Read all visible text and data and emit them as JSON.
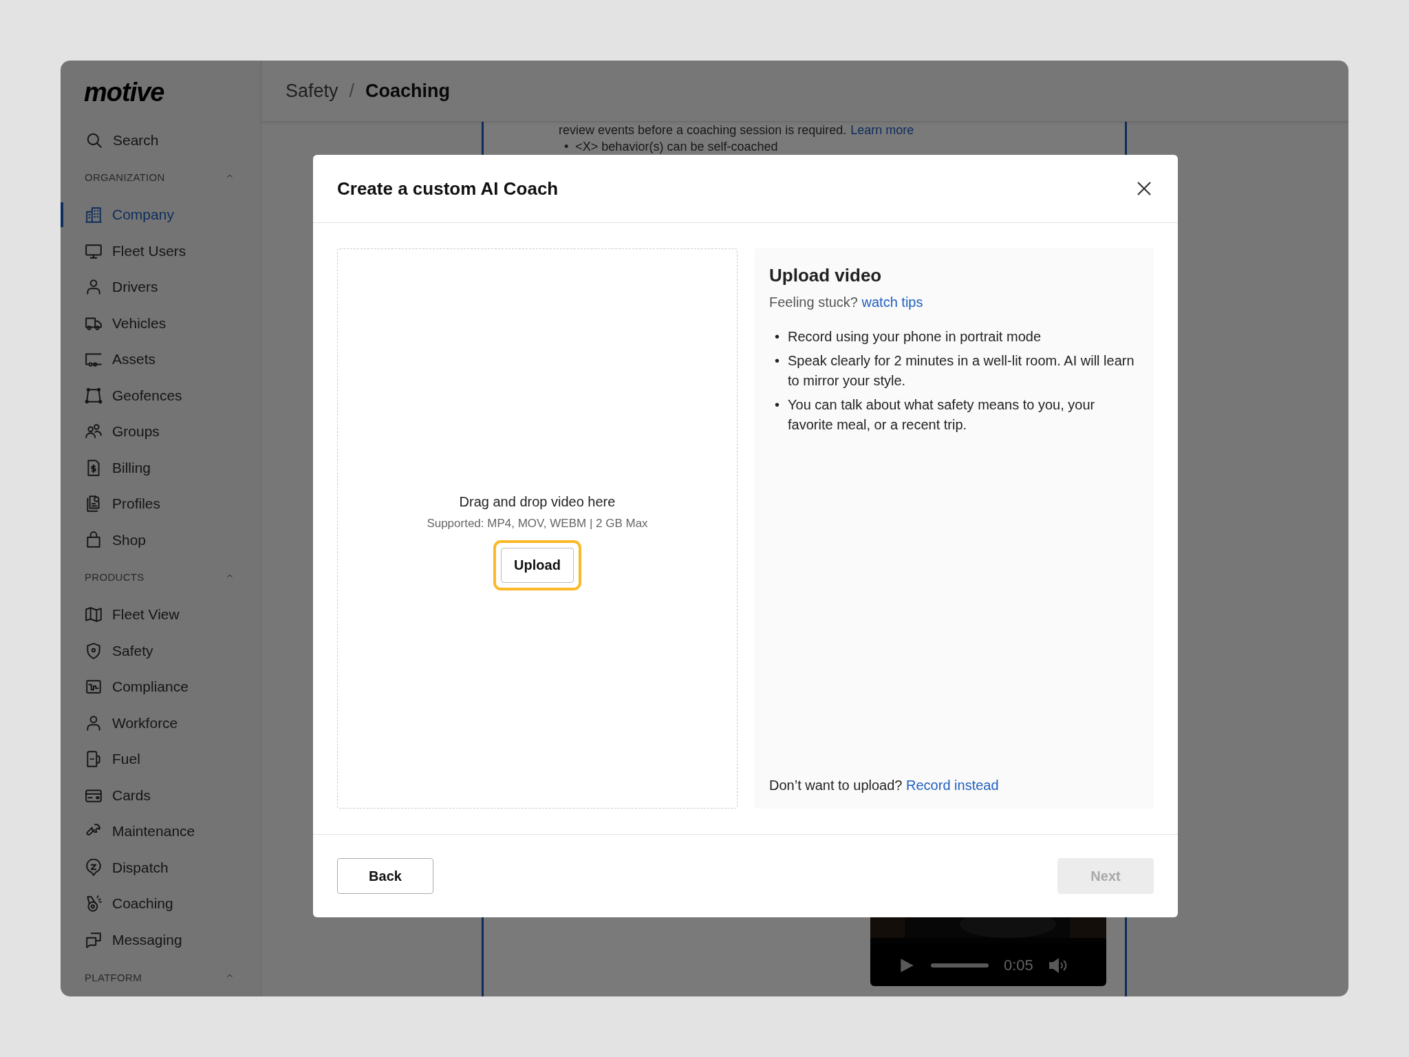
{
  "sidebar": {
    "logo": "motive",
    "search": "Search",
    "sections": [
      {
        "title": "ORGANIZATION",
        "expanded": true,
        "items": [
          {
            "label": "Company",
            "selected": true
          },
          {
            "label": "Fleet Users",
            "selected": false
          },
          {
            "label": "Drivers",
            "selected": false
          },
          {
            "label": "Vehicles",
            "selected": false
          },
          {
            "label": "Assets",
            "selected": false
          },
          {
            "label": "Geofences",
            "selected": false
          },
          {
            "label": "Groups",
            "selected": false
          },
          {
            "label": "Billing",
            "selected": false
          },
          {
            "label": "Profiles",
            "selected": false
          },
          {
            "label": "Shop",
            "selected": false
          }
        ]
      },
      {
        "title": "PRODUCTS",
        "expanded": true,
        "items": [
          {
            "label": "Fleet View",
            "selected": false
          },
          {
            "label": "Safety",
            "selected": false
          },
          {
            "label": "Compliance",
            "selected": false
          },
          {
            "label": "Workforce",
            "selected": false
          },
          {
            "label": "Fuel",
            "selected": false
          },
          {
            "label": "Cards",
            "selected": false
          },
          {
            "label": "Maintenance",
            "selected": false
          },
          {
            "label": "Dispatch",
            "selected": false
          },
          {
            "label": "Coaching",
            "selected": false
          },
          {
            "label": "Messaging",
            "selected": false
          }
        ]
      },
      {
        "title": "PLATFORM",
        "expanded": true
      }
    ]
  },
  "breadcrumb": {
    "parent": "Safety",
    "separator": "/",
    "current": "Coaching"
  },
  "background": {
    "text": "review events before a coaching session is required.",
    "link": "Learn more",
    "bullet_marker": "•",
    "bullets": [
      "<X> behavior(s) can be self-coached"
    ],
    "video": {
      "time": "0:05"
    }
  },
  "modal": {
    "title": "Create a custom AI Coach",
    "dropzone": {
      "title": "Drag and drop video here",
      "hint": "Supported: MP4, MOV, WEBM | 2 GB Max",
      "button": "Upload",
      "highlighted": true
    },
    "panel": {
      "title": "Upload video",
      "subtitle": "Feeling stuck?",
      "subtitle_link": "watch tips",
      "bullet_marker": "•",
      "bullets": [
        "Record using your phone in portrait mode",
        "Speak clearly for 2 minutes in a well-lit room. AI will learn to mirror your style.",
        "You can talk about what safety means to you, your favorite meal, or a recent trip."
      ],
      "footer": "Don’t want to upload?",
      "footer_link": "Record instead"
    },
    "buttons": [
      {
        "label": "Back",
        "kind": "secondary",
        "disabled": false
      },
      {
        "label": "Next",
        "kind": "primary",
        "disabled": true
      }
    ]
  }
}
